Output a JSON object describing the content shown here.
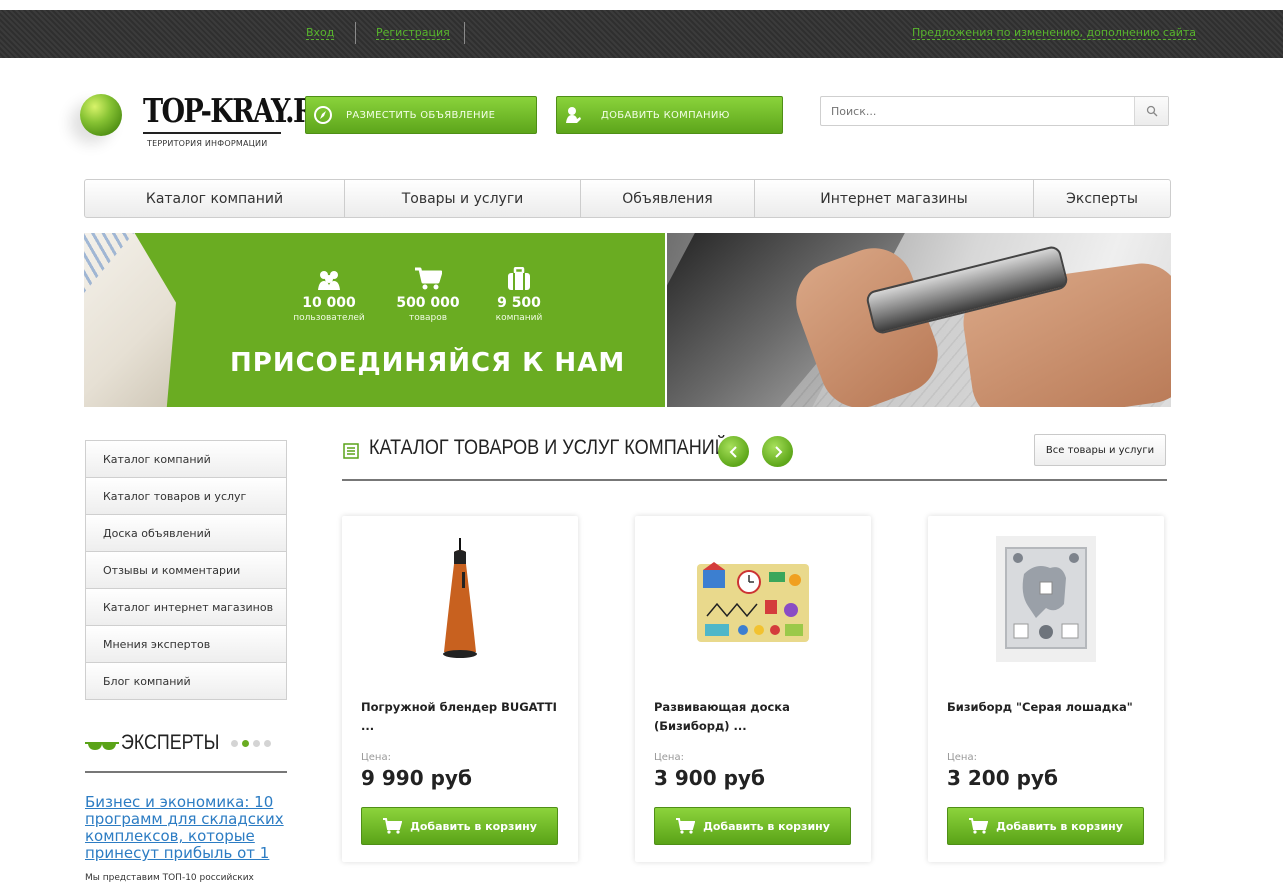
{
  "topbar": {
    "login": "Вход",
    "register": "Регистрация",
    "suggestions": "Предложения по изменению, дополнению сайта"
  },
  "header": {
    "logo_text": "TOP-KRAY.RU",
    "logo_subtitle": "ТЕРРИТОРИЯ ИНФОРМАЦИИ",
    "post_ad_label": "РАЗМЕСТИТЬ ОБЪЯВЛЕНИЕ",
    "add_company_label": "ДОБАВИТЬ КОМПАНИЮ",
    "search_placeholder": "Поиск..."
  },
  "nav": {
    "items": [
      "Каталог компаний",
      "Товары и услуги",
      "Объявления",
      "Интернет магазины",
      "Эксперты"
    ]
  },
  "banner": {
    "stats": [
      {
        "icon": "users-icon",
        "num": "10 000",
        "label": "пользователей"
      },
      {
        "icon": "cart-icon",
        "num": "500 000",
        "label": "товаров"
      },
      {
        "icon": "briefcase-icon",
        "num": "9 500",
        "label": "компаний"
      }
    ],
    "headline": "ПРИСОЕДИНЯЙСЯ К НАМ"
  },
  "sidebar": {
    "menu": [
      "Каталог компаний",
      "Каталог товаров и услуг",
      "Доска объявлений",
      "Отзывы и комментарии",
      "Каталог интернет магазинов",
      "Мнения экспертов",
      "Блог компаний"
    ],
    "experts_title": "ЭКСПЕРТЫ",
    "article_title": "Бизнес и экономика: 10 программ для складских комплексов, которые принесут прибыль от 1",
    "article_snippet": "Мы представим ТОП-10 российских"
  },
  "catalog": {
    "title": "КАТАЛОГ ТОВАРОВ И УСЛУГ КОМПАНИЙ",
    "all_button": "Все товары и услуги",
    "price_label": "Цена:",
    "cart_label": "Добавить в корзину",
    "products": [
      {
        "name": "Погружной блендер BUGATTI ...",
        "price": "9 990 руб"
      },
      {
        "name": "Развивающая доска (Бизиборд) ...",
        "price": "3 900 руб"
      },
      {
        "name": "Бизиборд \"Серая лошадка\"",
        "price": "3 200 руб"
      }
    ]
  },
  "colors": {
    "accent_green": "#6aac22",
    "link_blue": "#2c7cc3",
    "topbar_link": "#58b52d"
  }
}
